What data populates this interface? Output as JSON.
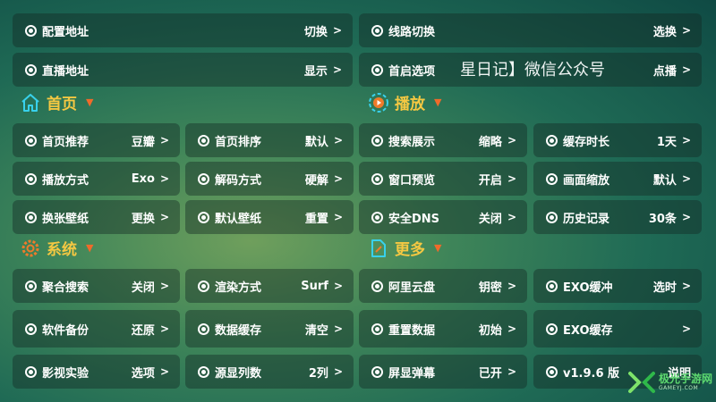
{
  "rows": {
    "config_url": {
      "label": "配置地址",
      "value": "切换"
    },
    "route_switch": {
      "label": "线路切换",
      "value": "选换"
    },
    "live_url": {
      "label": "直播地址",
      "value": "显示"
    },
    "startup": {
      "label": "首启选项",
      "value": "点播"
    }
  },
  "marquee_text": "星日记】微信公众号",
  "sections": {
    "home": "首页",
    "play": "播放",
    "system": "系统",
    "more": "更多"
  },
  "home": {
    "recommend": {
      "label": "首页推荐",
      "value": "豆瓣"
    },
    "sort": {
      "label": "首页排序",
      "value": "默认"
    },
    "play_mode": {
      "label": "播放方式",
      "value": "Exo"
    },
    "decode": {
      "label": "解码方式",
      "value": "硬解"
    },
    "wallpaper_switch": {
      "label": "换张壁纸",
      "value": "更换"
    },
    "default_wallpaper": {
      "label": "默认壁纸",
      "value": "重置"
    }
  },
  "play": {
    "search_display": {
      "label": "搜索展示",
      "value": "缩略"
    },
    "cache_time": {
      "label": "缓存时长",
      "value": "1天"
    },
    "window_preview": {
      "label": "窗口预览",
      "value": "开启"
    },
    "scale": {
      "label": "画面缩放",
      "value": "默认"
    },
    "safe_dns": {
      "label": "安全DNS",
      "value": "关闭"
    },
    "history": {
      "label": "历史记录",
      "value": "30条"
    }
  },
  "system": {
    "aggregate_search": {
      "label": "聚合搜索",
      "value": "关闭"
    },
    "render": {
      "label": "渲染方式",
      "value": "Surf"
    },
    "backup": {
      "label": "软件备份",
      "value": "还原"
    },
    "data_cache": {
      "label": "数据缓存",
      "value": "清空"
    },
    "lab": {
      "label": "影视实验",
      "value": "选项"
    },
    "source_cols": {
      "label": "源显列数",
      "value": "2列"
    }
  },
  "more": {
    "aliyun": {
      "label": "阿里云盘",
      "value": "钥密"
    },
    "exo_buffer": {
      "label": "EXO缓冲",
      "value": "选时"
    },
    "reset_data": {
      "label": "重置数据",
      "value": "初始"
    },
    "exo_cache": {
      "label": "EXO缓存",
      "value": ""
    },
    "danmaku": {
      "label": "屏显弹幕",
      "value": "已开"
    },
    "version": {
      "label": "v1.9.6 版",
      "value": "说明"
    }
  },
  "arrow": ">",
  "watermark": {
    "main": "极光手游网",
    "sub": "GAMEYJ.COM"
  },
  "colors": {
    "section_title": "#f5c842",
    "section_icon": "#38d1ec",
    "triangle": "#f06a2a",
    "system_icon": "#f07a2a"
  }
}
